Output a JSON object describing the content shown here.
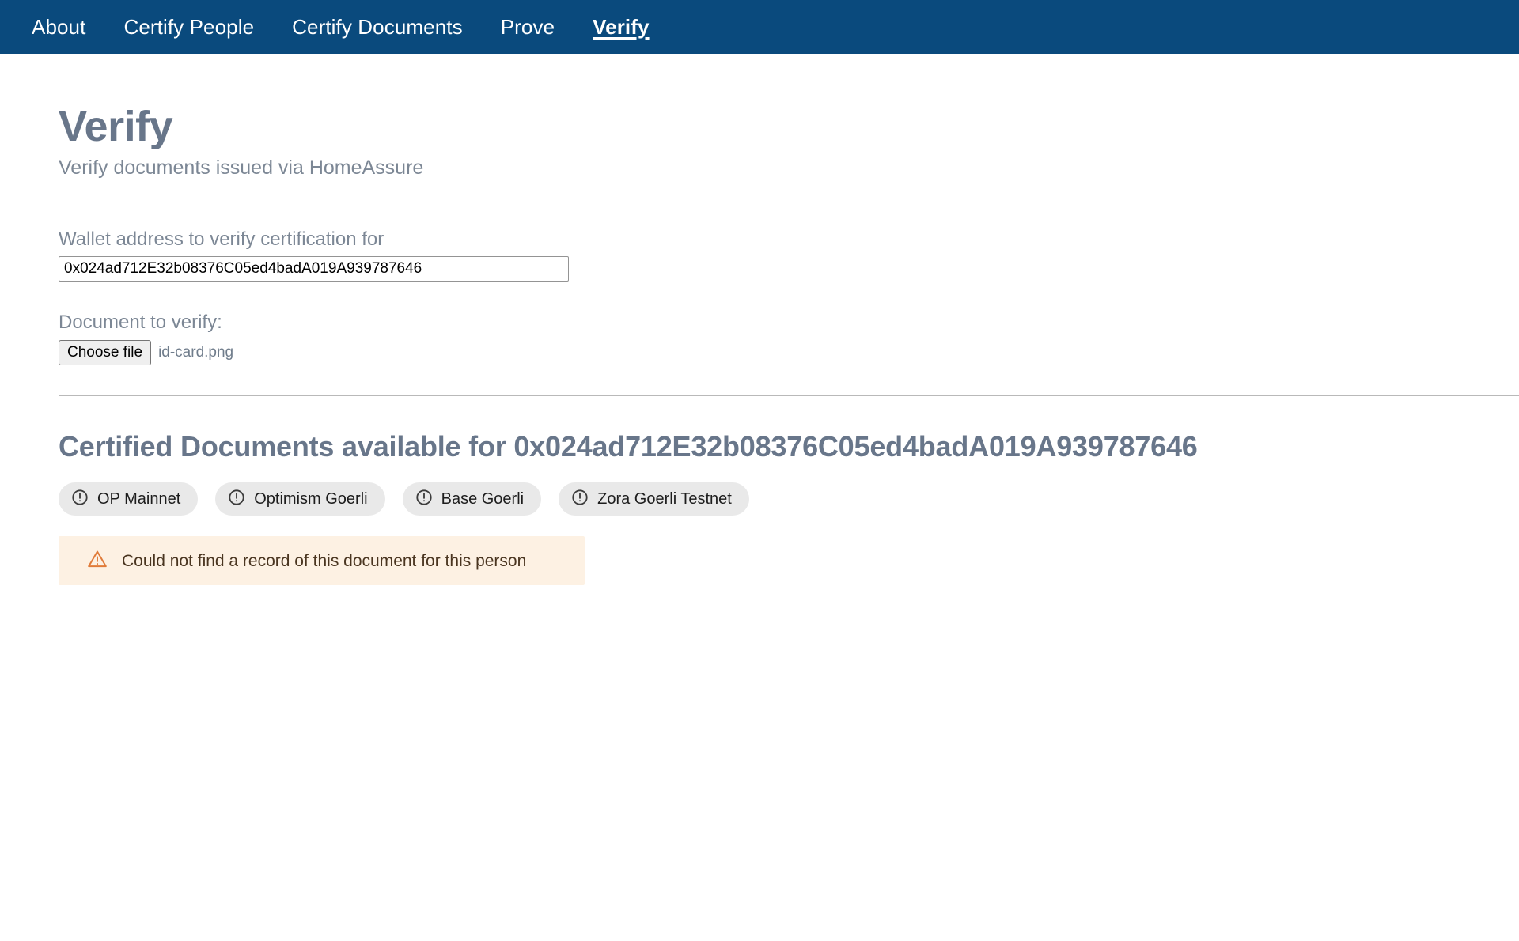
{
  "navbar": {
    "background": "#0a4a7d",
    "items": [
      {
        "label": "About",
        "active": false
      },
      {
        "label": "Certify People",
        "active": false
      },
      {
        "label": "Certify Documents",
        "active": false
      },
      {
        "label": "Prove",
        "active": false
      },
      {
        "label": "Verify",
        "active": true
      }
    ]
  },
  "header": {
    "title": "Verify",
    "subtitle": "Verify documents issued via HomeAssure",
    "title_color": "#68768a"
  },
  "form": {
    "wallet": {
      "label": "Wallet address to verify certification for",
      "value": "0x024ad712E32b08376C05ed4badA019A939787646",
      "placeholder": ""
    },
    "document": {
      "label": "Document to verify:",
      "choose_file_label": "Choose file",
      "file_name": "id-card.png"
    }
  },
  "results": {
    "heading": "Certified Documents available for 0x024ad712E32b08376C05ed4badA019A939787646",
    "chips": [
      {
        "label": "OP Mainnet",
        "icon": "exclamation-circle-icon"
      },
      {
        "label": "Optimism Goerli",
        "icon": "exclamation-circle-icon"
      },
      {
        "label": "Base Goerli",
        "icon": "exclamation-circle-icon"
      },
      {
        "label": "Zora Goerli Testnet",
        "icon": "exclamation-circle-icon"
      }
    ],
    "alert": {
      "icon": "warning-triangle-icon",
      "message": "Could not find a record of this document for this person",
      "background": "#fdf1e3",
      "icon_color": "#e07b39",
      "text_color": "#4a3520"
    }
  }
}
